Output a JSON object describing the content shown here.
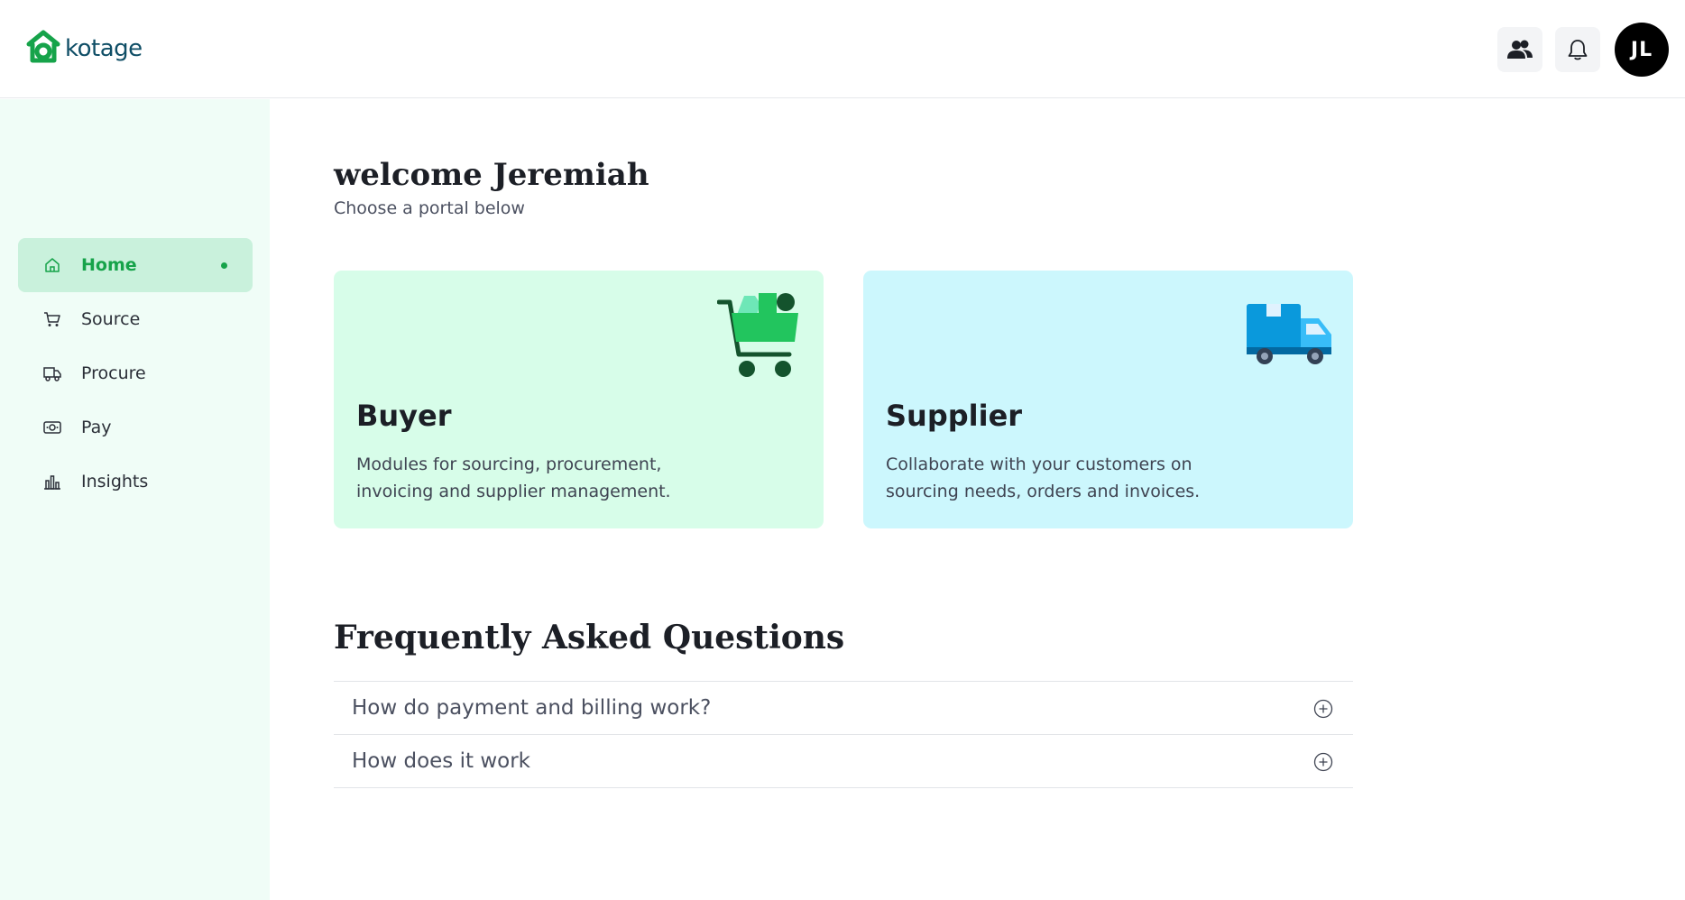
{
  "brand": {
    "name": "kotage",
    "color": "#16a34a",
    "text_color": "#0f4e66"
  },
  "header": {
    "users_icon": "users-icon",
    "notifications_icon": "bell-icon",
    "avatar_initials": "JL"
  },
  "sidebar": {
    "items": [
      {
        "label": "Home",
        "icon": "home-icon",
        "active": true
      },
      {
        "label": "Source",
        "icon": "cart-icon",
        "active": false
      },
      {
        "label": "Procure",
        "icon": "truck-icon",
        "active": false
      },
      {
        "label": "Pay",
        "icon": "money-icon",
        "active": false
      },
      {
        "label": "Insights",
        "icon": "bar-chart-icon",
        "active": false
      }
    ]
  },
  "main": {
    "welcome": "welcome Jeremiah",
    "subtitle": "Choose a portal below",
    "portals": [
      {
        "title": "Buyer",
        "description": "Modules for sourcing, procurement, invoicing and supplier management.",
        "icon": "shopping-cart-illustration",
        "color": "#d7fde9"
      },
      {
        "title": "Supplier",
        "description": "Collaborate with your customers on sourcing needs, orders and invoices.",
        "icon": "delivery-truck-illustration",
        "color": "#ccf7fd"
      }
    ],
    "faq": {
      "title": "Frequently Asked Questions",
      "items": [
        {
          "question": "How do payment and billing work?"
        },
        {
          "question": "How does it work"
        }
      ]
    }
  }
}
